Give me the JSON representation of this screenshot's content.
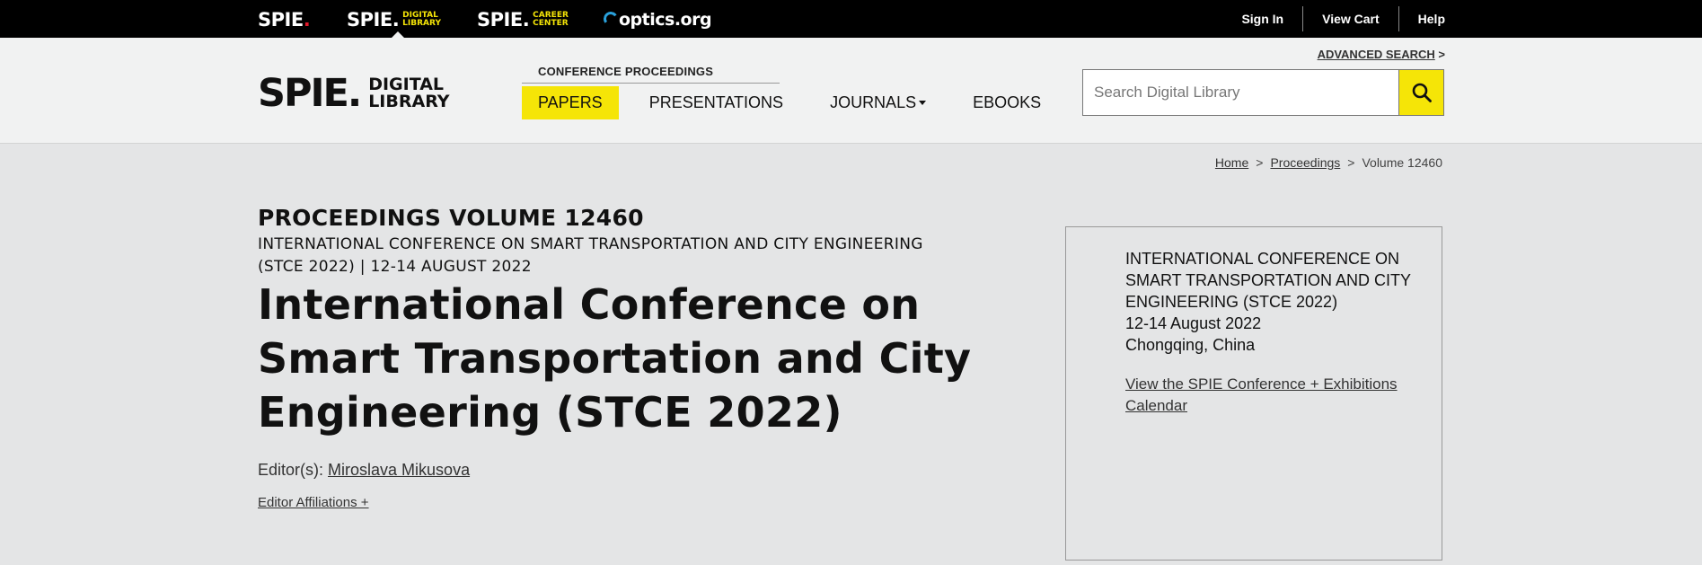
{
  "topbar": {
    "brands": [
      {
        "name": "SPIE",
        "sub": ""
      },
      {
        "name": "SPIE",
        "sub": "DIGITAL LIBRARY"
      },
      {
        "name": "SPIE",
        "sub": "CAREER CENTER"
      }
    ],
    "optics": "optics.org",
    "links": [
      "Sign In",
      "View Cart",
      "Help"
    ]
  },
  "header": {
    "logo_main": "SPIE",
    "logo_sub_1": "DIGITAL",
    "logo_sub_2": "LIBRARY",
    "section_label": "CONFERENCE PROCEEDINGS",
    "nav": [
      {
        "label": "PAPERS",
        "active": true
      },
      {
        "label": "PRESENTATIONS",
        "active": false
      },
      {
        "label": "JOURNALS",
        "active": false,
        "dropdown": true
      },
      {
        "label": "EBOOKS",
        "active": false
      }
    ],
    "advanced_search": "ADVANCED SEARCH",
    "search_placeholder": "Search Digital Library",
    "accent_color": "#f5e507"
  },
  "breadcrumb": {
    "items": [
      "Home",
      "Proceedings",
      "Volume 12460"
    ],
    "separator": ">"
  },
  "content": {
    "volume": "PROCEEDINGS VOLUME 12460",
    "conference_line_1": "INTERNATIONAL CONFERENCE ON SMART TRANSPORTATION AND CITY ENGINEERING",
    "conference_line_2": "(STCE 2022) | 12-14 AUGUST 2022",
    "title": "International Conference on Smart Transportation and City Engineering (STCE 2022)",
    "editors_label": "Editor(s):",
    "editor_name": "Miroslava Mikusova",
    "affiliations": "Editor Affiliations +"
  },
  "infobox": {
    "conference": "INTERNATIONAL CONFERENCE ON SMART TRANSPORTATION AND CITY ENGINEERING (STCE 2022)",
    "dates": "12-14 August 2022",
    "location": "Chongqing, China",
    "calendar_link": "View the SPIE Conference + Exhibitions Calendar"
  }
}
